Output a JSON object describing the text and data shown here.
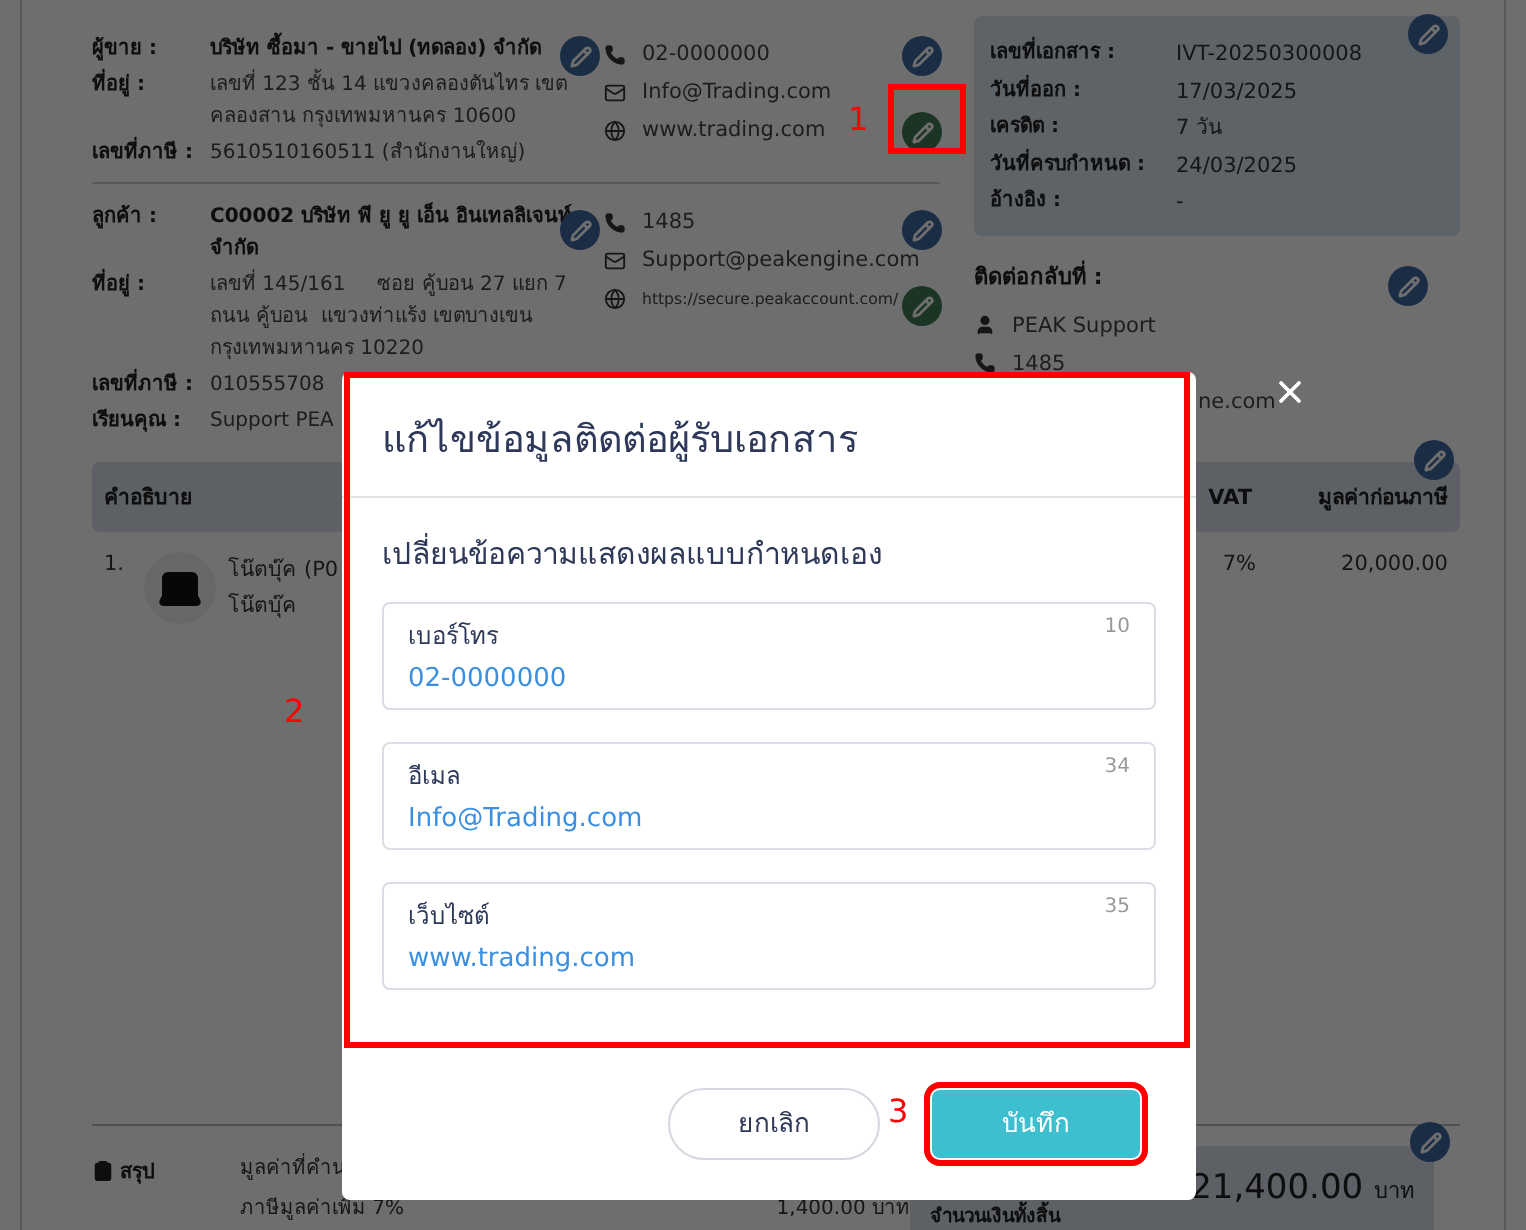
{
  "seller": {
    "rows": [
      {
        "label": "ผู้ขาย :",
        "lines": [
          "บริษัท ซื้อมา - ขายไป (ทดลอง) จำกัด"
        ],
        "bold": true
      },
      {
        "label": "ที่อยู่ :",
        "lines": [
          "เลขที่ 123 ชั้น 14 แขวงคลองตันไทร เขต",
          "คลองสาน กรุงเทพมหานคร 10600"
        ],
        "bold": false
      },
      {
        "label": "เลขที่ภาษี :",
        "lines": [
          "5610510160511 (สำนักงานใหญ่)"
        ],
        "bold": false
      }
    ],
    "contact": [
      {
        "kind": "phone",
        "text": "02-0000000"
      },
      {
        "kind": "email",
        "text": "Info@Trading.com"
      },
      {
        "kind": "web",
        "text": "www.trading.com"
      }
    ]
  },
  "customer": {
    "rows": [
      {
        "label": "ลูกค้า :",
        "lines": [
          "C00002 บริษัท พี ยู ยู เอ็น อินเทลลิเจนท์",
          "จำกัด"
        ],
        "bold": true
      },
      {
        "label": "ที่อยู่ :",
        "lines": [
          "เลขที่ 145/161     ซอย คู้บอน 27 แยก 7",
          "ถนน คู้บอน  แขวงท่าแร้ง เขตบางเขน",
          "กรุงเทพมหานคร 10220"
        ],
        "bold": false
      },
      {
        "label": "เลขที่ภาษี :",
        "lines": [
          "010555708"
        ],
        "bold": false
      },
      {
        "label": "เรียนคุณ :",
        "lines": [
          "Support PEA"
        ],
        "bold": false
      }
    ],
    "contact": [
      {
        "kind": "phone",
        "text": "1485"
      },
      {
        "kind": "email",
        "text": "Support@peakengine.com"
      },
      {
        "kind": "web",
        "text": "https://secure.peakaccount.com/"
      }
    ]
  },
  "document": {
    "rows": [
      {
        "label": "เลขที่เอกสาร :",
        "value": "IVT-20250300008"
      },
      {
        "label": "วันที่ออก :",
        "value": "17/03/2025"
      },
      {
        "label": "เครดิต :",
        "value": "7 วัน"
      },
      {
        "label": "วันที่ครบกำหนด :",
        "value": "24/03/2025"
      },
      {
        "label": "อ้างอิง :",
        "value": "-"
      }
    ]
  },
  "reply_contact": {
    "title": "ติดต่อกลับที่ :",
    "rows": [
      {
        "kind": "person",
        "text": "PEAK Support"
      },
      {
        "kind": "phone",
        "text": "1485"
      },
      {
        "kind": "email",
        "text": "ne.com"
      }
    ]
  },
  "table": {
    "columns": [
      "คำอธิบาย",
      "VAT",
      "มูลค่าก่อนภาษี"
    ],
    "rows": [
      {
        "number": "1.",
        "name": "โน๊ตบุ๊ค",
        "code": "(P0",
        "subtitle": "โน๊ตบุ๊ค",
        "vat": "7%",
        "amount": "20,000.00"
      }
    ]
  },
  "summary": {
    "title": "สรุป",
    "lines": [
      {
        "label": "มูลค่าที่คำน"
      },
      {
        "label": "ภาษีมูลค่าเพิ่ม 7%",
        "value": "1,400.00",
        "unit": "บาท"
      }
    ],
    "total": {
      "label": "จำนวนเงินทั้งสิ้น",
      "value": "21,400.00",
      "unit": "บาท"
    }
  },
  "modal": {
    "title": "แก้ไขข้อมูลติดต่อผู้รับเอกสาร",
    "subtitle": "เปลี่ยนข้อความแสดงผลแบบกำหนดเอง",
    "fields": [
      {
        "label": "เบอร์โทร",
        "value": "02-0000000",
        "count": "10"
      },
      {
        "label": "อีเมล",
        "value": "Info@Trading.com",
        "count": "34"
      },
      {
        "label": "เว็บไซต์",
        "value": "www.trading.com",
        "count": "35"
      }
    ],
    "cancel": "ยกเลิก",
    "save": "บันทึก"
  },
  "annotations": [
    "1",
    "2",
    "3"
  ]
}
